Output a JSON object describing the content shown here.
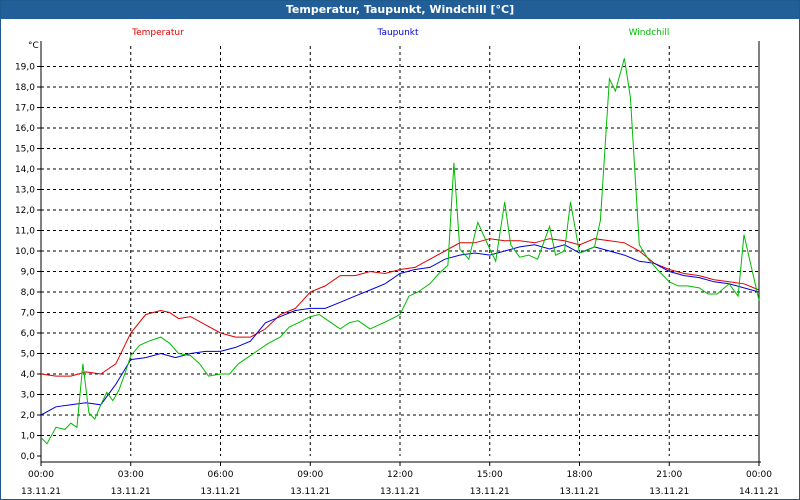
{
  "window": {
    "title": "Temperatur, Taupunkt, Windchill [°C]"
  },
  "chart_data": {
    "type": "line",
    "title": "Temperatur, Taupunkt, Windchill [°C]",
    "ylabel": "°C",
    "ylim": [
      0.0,
      20.0
    ],
    "xlim": [
      0,
      24
    ],
    "grid": true,
    "legend": "top",
    "y_ticks": [
      "0,0",
      "1,0",
      "2,0",
      "3,0",
      "4,0",
      "5,0",
      "6,0",
      "7,0",
      "8,0",
      "9,0",
      "10,0",
      "11,0",
      "12,0",
      "13,0",
      "14,0",
      "15,0",
      "16,0",
      "17,0",
      "18,0",
      "19,0"
    ],
    "x_ticks": [
      {
        "h": 0,
        "time": "00:00",
        "date": "13.11.21"
      },
      {
        "h": 3,
        "time": "03:00",
        "date": "13.11.21"
      },
      {
        "h": 6,
        "time": "06:00",
        "date": "13.11.21"
      },
      {
        "h": 9,
        "time": "09:00",
        "date": "13.11.21"
      },
      {
        "h": 12,
        "time": "12:00",
        "date": "13.11.21"
      },
      {
        "h": 15,
        "time": "15:00",
        "date": "13.11.21"
      },
      {
        "h": 18,
        "time": "18:00",
        "date": "13.11.21"
      },
      {
        "h": 21,
        "time": "21:00",
        "date": "13.11.21"
      },
      {
        "h": 24,
        "time": "00:00",
        "date": "14.11.21"
      }
    ],
    "series": [
      {
        "name": "Temperatur",
        "color": "#e00000",
        "points": [
          [
            0,
            4.0
          ],
          [
            0.5,
            3.9
          ],
          [
            1,
            3.9
          ],
          [
            1.5,
            4.1
          ],
          [
            2,
            4.0
          ],
          [
            2.5,
            4.5
          ],
          [
            3,
            6.0
          ],
          [
            3.5,
            6.9
          ],
          [
            4,
            7.1
          ],
          [
            4.3,
            7.0
          ],
          [
            4.6,
            6.7
          ],
          [
            5,
            6.8
          ],
          [
            5.5,
            6.4
          ],
          [
            6,
            6.0
          ],
          [
            6.5,
            5.8
          ],
          [
            7,
            5.8
          ],
          [
            7.5,
            6.2
          ],
          [
            8,
            6.9
          ],
          [
            8.5,
            7.2
          ],
          [
            9,
            8.0
          ],
          [
            9.5,
            8.3
          ],
          [
            10,
            8.8
          ],
          [
            10.5,
            8.8
          ],
          [
            11,
            9.0
          ],
          [
            11.5,
            8.9
          ],
          [
            12,
            9.1
          ],
          [
            12.5,
            9.2
          ],
          [
            13,
            9.6
          ],
          [
            13.5,
            10.0
          ],
          [
            14,
            10.4
          ],
          [
            14.5,
            10.4
          ],
          [
            15,
            10.6
          ],
          [
            15.5,
            10.5
          ],
          [
            16,
            10.5
          ],
          [
            16.5,
            10.4
          ],
          [
            17,
            10.6
          ],
          [
            17.5,
            10.5
          ],
          [
            18,
            10.3
          ],
          [
            18.5,
            10.6
          ],
          [
            19,
            10.5
          ],
          [
            19.5,
            10.4
          ],
          [
            20,
            10.0
          ],
          [
            20.5,
            9.4
          ],
          [
            21,
            9.1
          ],
          [
            21.5,
            8.9
          ],
          [
            22,
            8.8
          ],
          [
            22.5,
            8.6
          ],
          [
            23,
            8.5
          ],
          [
            23.5,
            8.4
          ],
          [
            24,
            8.1
          ]
        ]
      },
      {
        "name": "Taupunkt",
        "color": "#0000dd",
        "points": [
          [
            0,
            2.0
          ],
          [
            0.5,
            2.4
          ],
          [
            1,
            2.5
          ],
          [
            1.5,
            2.6
          ],
          [
            2,
            2.5
          ],
          [
            2.5,
            3.5
          ],
          [
            3,
            4.7
          ],
          [
            3.5,
            4.8
          ],
          [
            4,
            5.0
          ],
          [
            4.5,
            4.8
          ],
          [
            5,
            5.0
          ],
          [
            5.5,
            5.1
          ],
          [
            6,
            5.1
          ],
          [
            6.5,
            5.3
          ],
          [
            7,
            5.6
          ],
          [
            7.5,
            6.5
          ],
          [
            8,
            6.8
          ],
          [
            8.5,
            7.1
          ],
          [
            9,
            7.2
          ],
          [
            9.5,
            7.2
          ],
          [
            10,
            7.5
          ],
          [
            10.5,
            7.8
          ],
          [
            11,
            8.1
          ],
          [
            11.5,
            8.4
          ],
          [
            12,
            8.9
          ],
          [
            12.5,
            9.1
          ],
          [
            13,
            9.2
          ],
          [
            13.5,
            9.6
          ],
          [
            14,
            9.8
          ],
          [
            14.5,
            9.9
          ],
          [
            15,
            9.8
          ],
          [
            15.5,
            10.0
          ],
          [
            16,
            10.2
          ],
          [
            16.5,
            10.3
          ],
          [
            17,
            10.1
          ],
          [
            17.5,
            10.3
          ],
          [
            18,
            9.9
          ],
          [
            18.5,
            10.2
          ],
          [
            19,
            10.0
          ],
          [
            19.5,
            9.8
          ],
          [
            20,
            9.5
          ],
          [
            20.5,
            9.4
          ],
          [
            21,
            9.0
          ],
          [
            21.5,
            8.8
          ],
          [
            22,
            8.7
          ],
          [
            22.5,
            8.5
          ],
          [
            23,
            8.4
          ],
          [
            23.5,
            8.2
          ],
          [
            24,
            8.0
          ]
        ]
      },
      {
        "name": "Windchill",
        "color": "#00bb00",
        "points": [
          [
            0,
            0.9
          ],
          [
            0.2,
            0.6
          ],
          [
            0.5,
            1.4
          ],
          [
            0.8,
            1.3
          ],
          [
            1,
            1.6
          ],
          [
            1.2,
            1.4
          ],
          [
            1.4,
            4.5
          ],
          [
            1.6,
            2.1
          ],
          [
            1.8,
            1.8
          ],
          [
            2,
            2.5
          ],
          [
            2.2,
            3.1
          ],
          [
            2.4,
            2.7
          ],
          [
            2.6,
            3.2
          ],
          [
            2.8,
            4.0
          ],
          [
            3,
            4.9
          ],
          [
            3.3,
            5.4
          ],
          [
            3.6,
            5.6
          ],
          [
            4,
            5.8
          ],
          [
            4.3,
            5.5
          ],
          [
            4.6,
            5.0
          ],
          [
            5,
            4.9
          ],
          [
            5.3,
            4.5
          ],
          [
            5.6,
            3.9
          ],
          [
            6,
            4.0
          ],
          [
            6.3,
            4.0
          ],
          [
            6.6,
            4.5
          ],
          [
            7,
            4.9
          ],
          [
            7.3,
            5.2
          ],
          [
            7.6,
            5.5
          ],
          [
            8,
            5.8
          ],
          [
            8.3,
            6.3
          ],
          [
            8.6,
            6.5
          ],
          [
            9,
            6.8
          ],
          [
            9.3,
            6.9
          ],
          [
            9.6,
            6.6
          ],
          [
            10,
            6.2
          ],
          [
            10.3,
            6.5
          ],
          [
            10.6,
            6.6
          ],
          [
            11,
            6.2
          ],
          [
            11.3,
            6.4
          ],
          [
            11.6,
            6.6
          ],
          [
            12,
            6.9
          ],
          [
            12.3,
            7.8
          ],
          [
            12.6,
            8.0
          ],
          [
            13,
            8.4
          ],
          [
            13.3,
            8.9
          ],
          [
            13.6,
            9.3
          ],
          [
            13.8,
            14.3
          ],
          [
            14,
            10.1
          ],
          [
            14.3,
            9.6
          ],
          [
            14.6,
            11.4
          ],
          [
            15,
            10.1
          ],
          [
            15.2,
            9.5
          ],
          [
            15.5,
            12.4
          ],
          [
            15.7,
            10.3
          ],
          [
            16,
            9.7
          ],
          [
            16.3,
            9.8
          ],
          [
            16.6,
            9.6
          ],
          [
            17,
            11.2
          ],
          [
            17.2,
            9.8
          ],
          [
            17.5,
            10.0
          ],
          [
            17.7,
            12.4
          ],
          [
            18,
            9.9
          ],
          [
            18.2,
            10.0
          ],
          [
            18.5,
            10.2
          ],
          [
            18.7,
            11.5
          ],
          [
            19,
            18.4
          ],
          [
            19.2,
            17.8
          ],
          [
            19.5,
            19.4
          ],
          [
            19.7,
            17.5
          ],
          [
            20,
            10.3
          ],
          [
            20.3,
            9.6
          ],
          [
            20.6,
            9.1
          ],
          [
            21,
            8.5
          ],
          [
            21.3,
            8.3
          ],
          [
            21.6,
            8.3
          ],
          [
            22,
            8.2
          ],
          [
            22.3,
            7.9
          ],
          [
            22.6,
            7.9
          ],
          [
            23,
            8.4
          ],
          [
            23.3,
            7.8
          ],
          [
            23.5,
            10.8
          ],
          [
            23.7,
            9.5
          ],
          [
            24,
            7.6
          ]
        ]
      }
    ]
  }
}
